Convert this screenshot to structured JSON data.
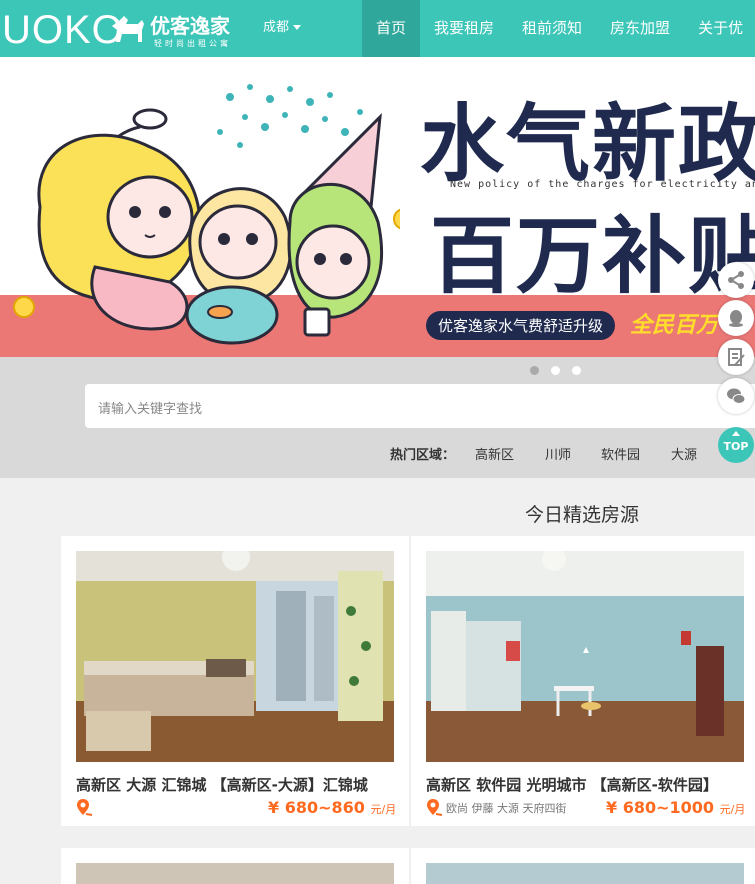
{
  "header": {
    "logo_text": "UOKO",
    "logo_cn": "优客逸家",
    "logo_sub": "轻时尚出租公寓",
    "city": "成都",
    "nav": [
      "首页",
      "我要租房",
      "租前须知",
      "房东加盟",
      "关于优"
    ]
  },
  "banner": {
    "headline_1": "水气新政",
    "headline_en": "New policy of the charges for electricity and g",
    "headline_2": "百万补贴",
    "pill": "优客逸家水气费舒适升级",
    "slogan": "全民百万"
  },
  "search": {
    "placeholder": "请输入关键字查找",
    "hot_label": "热门区域：",
    "hot_areas": [
      "高新区",
      "川师",
      "软件园",
      "大源"
    ]
  },
  "side_tools": {
    "top_label": "TOP"
  },
  "section_title": "今日精选房源",
  "listings": [
    {
      "title": "高新区 大源 汇锦城 【高新区-大源】汇锦城",
      "tags": "",
      "price": "¥ 680~860",
      "unit": "元/月"
    },
    {
      "title": "高新区 软件园 光明城市 【高新区-软件园】",
      "tags": "欧尚 伊藤 大源 天府四街",
      "price": "¥ 680~1000",
      "unit": "元/月"
    }
  ],
  "colors": {
    "brand": "#3cc6b8",
    "brand_dark": "#2fa89b",
    "price": "#ff6a21",
    "banner_band": "#ec7876",
    "banner_text": "#1f2a4e"
  }
}
